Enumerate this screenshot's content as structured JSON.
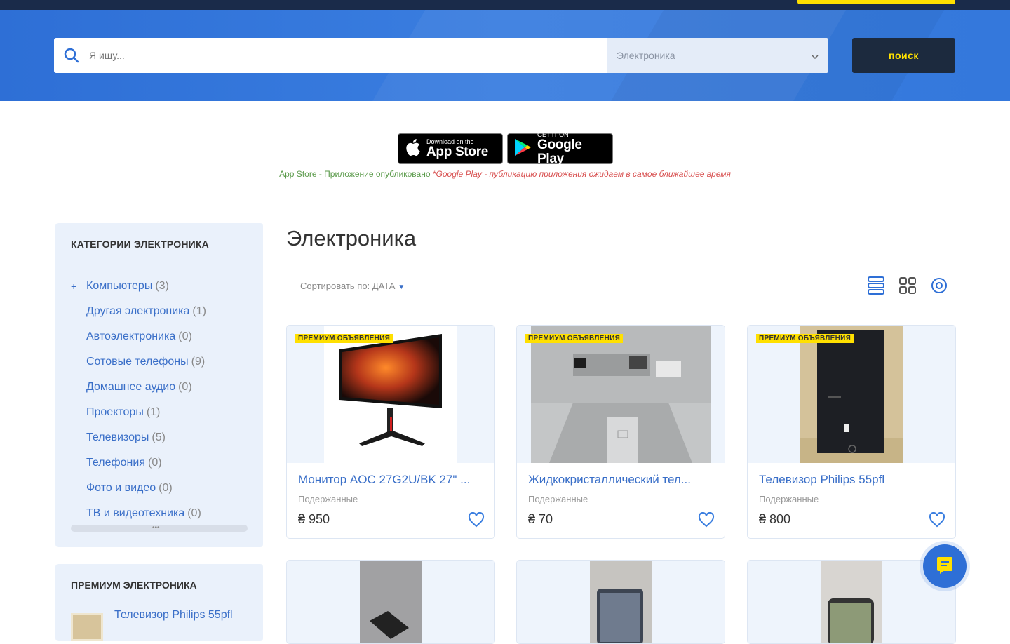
{
  "header": {
    "search_placeholder": "Я ищу...",
    "category_selected": "Электроника",
    "search_button": "поиск"
  },
  "apps": {
    "appstore_small": "Download on the",
    "appstore_big": "App Store",
    "gplay_small": "GET IT ON",
    "gplay_big": "Google Play",
    "notice_green": "App Store - Приложение опубликовано",
    "notice_red": "*Google Play - публикацию приложения ожидаем в самое ближайшее время"
  },
  "sidebar": {
    "title": "КАТЕГОРИИ ЭЛЕКТРОНИКА",
    "items": [
      {
        "label": "Компьютеры",
        "count": "(3)"
      },
      {
        "label": "Другая электроника",
        "count": "(1)"
      },
      {
        "label": "Автоэлектроника",
        "count": "(0)"
      },
      {
        "label": "Сотовые телефоны",
        "count": "(9)"
      },
      {
        "label": "Домашнее аудио",
        "count": "(0)"
      },
      {
        "label": "Проекторы",
        "count": "(1)"
      },
      {
        "label": "Телевизоры",
        "count": "(5)"
      },
      {
        "label": "Телефония",
        "count": "(0)"
      },
      {
        "label": "Фото и видео",
        "count": "(0)"
      },
      {
        "label": "ТВ и видеотехника",
        "count": "(0)"
      }
    ],
    "scroll_dots": "•••"
  },
  "premium": {
    "title": "ПРЕМИУМ ЭЛЕКТРОНИКА",
    "item_title": "Телевизор Philips 55pfl"
  },
  "main": {
    "title": "Электроника",
    "sort_label": "Сортировать по: ДАТА"
  },
  "listings": [
    {
      "badge": "ПРЕМИУМ ОБЪЯВЛЕНИЯ",
      "title": "Монитор AOC 27G2U/BK 27\" ...",
      "condition": "Подержанные",
      "price": "₴ 950"
    },
    {
      "badge": "ПРЕМИУМ ОБЪЯВЛЕНИЯ",
      "title": "Жидкокристаллический тел...",
      "condition": "Подержанные",
      "price": "₴ 70"
    },
    {
      "badge": "ПРЕМИУМ ОБЪЯВЛЕНИЯ",
      "title": "Телевизор Philips 55pfl",
      "condition": "Подержанные",
      "price": "₴ 800"
    }
  ],
  "colors": {
    "brand_blue": "#2e6fd6",
    "accent_yellow": "#ffe000",
    "dark_navy": "#1c2a3e",
    "link_blue": "#3a6fc8"
  },
  "icons": [
    "search-icon",
    "chevron-down-icon",
    "apple-icon",
    "google-play-icon",
    "list-view-icon",
    "grid-view-icon",
    "map-pin-icon",
    "heart-icon",
    "chat-icon"
  ]
}
